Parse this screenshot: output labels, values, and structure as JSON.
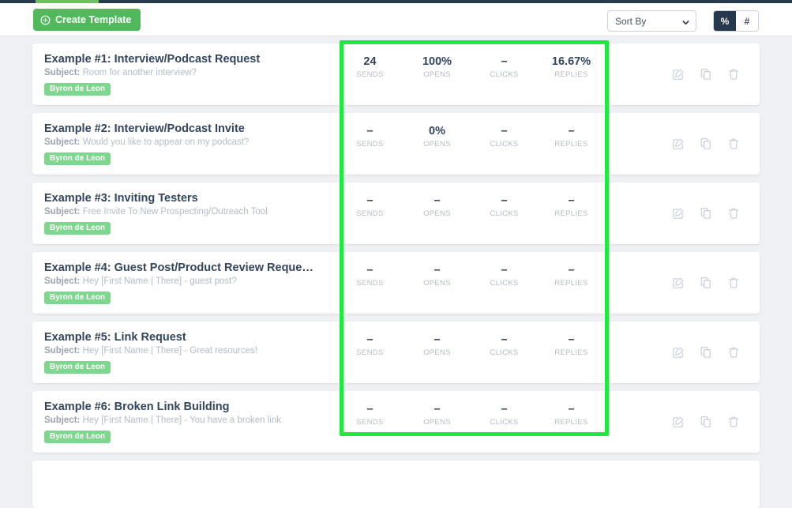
{
  "toolbar": {
    "create_template_label": "Create Template",
    "sort_by_label": "Sort By",
    "unit_percent_label": "%",
    "unit_number_label": "#",
    "unit_active": "%"
  },
  "colors": {
    "brand_green": "#4fb95b",
    "badge_green": "#7fd68f",
    "annotation_green": "#20e83c",
    "dark_navy": "#26384d",
    "title_text": "#31455c",
    "muted_text": "#b4bcc8"
  },
  "stat_columns": [
    "SENDS",
    "OPENS",
    "CLICKS",
    "REPLIES"
  ],
  "subject_prefix": "Subject:",
  "templates": [
    {
      "title": "Example #1: Interview/Podcast Request",
      "subject": "Room for another interview?",
      "owner": "Byron de Leon",
      "sends": "24",
      "opens": "100%",
      "clicks": "–",
      "replies": "16.67%"
    },
    {
      "title": "Example #2: Interview/Podcast Invite",
      "subject": "Would you like to appear on my podcast?",
      "owner": "Byron de Leon",
      "sends": "–",
      "opens": "0%",
      "clicks": "–",
      "replies": "–"
    },
    {
      "title": "Example #3: Inviting Testers",
      "subject": "Free Invite To New Prospecting/Outreach Tool",
      "owner": "Byron de Leon",
      "sends": "–",
      "opens": "–",
      "clicks": "–",
      "replies": "–"
    },
    {
      "title": "Example #4: Guest Post/Product Review Reque…",
      "subject": "Hey [First Name | There] - guest post?",
      "owner": "Byron de Leon",
      "sends": "–",
      "opens": "–",
      "clicks": "–",
      "replies": "–"
    },
    {
      "title": "Example #5: Link Request",
      "subject": "Hey [First Name | There] - Great resources!",
      "owner": "Byron de Leon",
      "sends": "–",
      "opens": "–",
      "clicks": "–",
      "replies": "–"
    },
    {
      "title": "Example #6: Broken Link Building",
      "subject": "Hey [First Name | There] - You have a broken link",
      "owner": "Byron de Leon",
      "sends": "–",
      "opens": "–",
      "clicks": "–",
      "replies": "–"
    }
  ],
  "row_actions": {
    "edit_label": "Edit",
    "duplicate_label": "Duplicate",
    "delete_label": "Delete"
  }
}
